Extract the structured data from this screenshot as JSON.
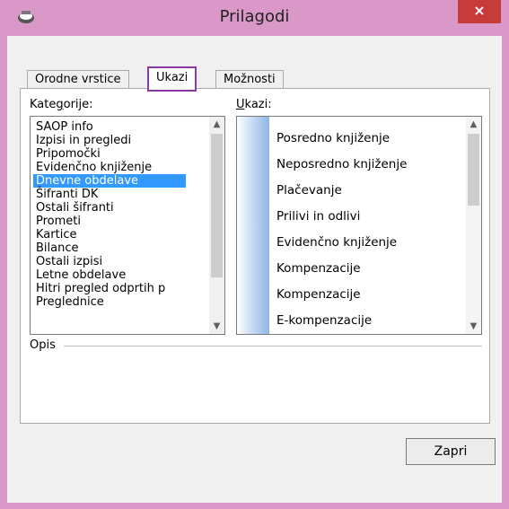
{
  "window": {
    "title": "Prilagodi",
    "close_glyph": "×",
    "icon": "app-icon"
  },
  "tabs": [
    {
      "label": "Orodne vrstice"
    },
    {
      "label": "Ukazi",
      "active": true
    },
    {
      "label": "Možnosti"
    }
  ],
  "categories": {
    "label_pre": "Kate",
    "label_u": "g",
    "label_post": "orije:",
    "items": [
      "SAOP info",
      "Izpisi in pregledi",
      "Pripomočki",
      "Evidenčno knjiženje",
      "Dnevne obdelave",
      "Šifranti DK",
      "Ostali šifranti",
      "Prometi",
      "Kartice",
      "Bilance",
      "Ostali izpisi",
      "Letne obdelave",
      "Hitri pregled odprtih p",
      "Preglednice"
    ],
    "selected_index": 4
  },
  "commands": {
    "label_u": "U",
    "label_post": "kazi:",
    "items": [
      {
        "label": "Posredno knjiženje",
        "submenu": false
      },
      {
        "label": "Neposredno knjiženje",
        "submenu": false
      },
      {
        "label": "Plačevanje",
        "submenu": false
      },
      {
        "label": "Prilivi in odlivi",
        "submenu": false
      },
      {
        "label": "Evidenčno knjiženje",
        "submenu": true
      },
      {
        "label": "Kompenzacije",
        "submenu": true
      },
      {
        "label": "Kompenzacije",
        "submenu": false
      },
      {
        "label": "E-kompenzacije",
        "submenu": false
      }
    ]
  },
  "description": {
    "label": "Opis",
    "text": ""
  },
  "buttons": {
    "close": "Zapri"
  },
  "icons": {
    "submenu": "▶",
    "scroll_up": "▲",
    "scroll_down": "▼"
  }
}
